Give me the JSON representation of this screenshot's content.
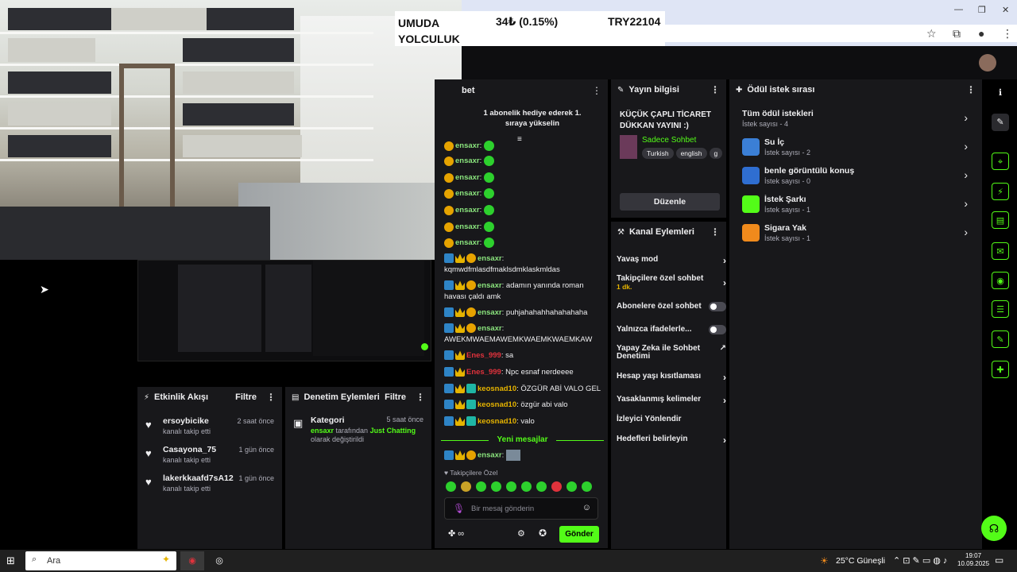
{
  "ticker": {
    "name_line1": "UMUDA",
    "name_line2": "YOLCULUK",
    "price": "34₺ (0.15%)",
    "goal": "TRY22104"
  },
  "activity": {
    "title": "Etkinlik Akışı",
    "filter": "Filtre",
    "items": [
      {
        "name": "ersoybicike",
        "sub": "kanalı takip etti",
        "time": "2 saat önce"
      },
      {
        "name": "Casayona_75",
        "sub": "kanalı takip etti",
        "time": "1 gün önce"
      },
      {
        "name": "lakerkkaafd7sA12",
        "sub": "kanalı takip etti",
        "time": "1 gün önce"
      }
    ]
  },
  "moderation": {
    "title": "Denetim Eylemleri",
    "filter": "Filtre",
    "item": {
      "title": "Kategori",
      "time": "5 saat önce",
      "user": "ensaxr",
      "mid": " tarafından ",
      "category": "Just Chatting",
      "end": "olarak değiştirildi"
    }
  },
  "chat": {
    "title_partial": "bet",
    "gift_banner": "1 abonelik hediye ederek 1. sıraya yükselin",
    "lines": [
      {
        "user": "ensaxr",
        "text": ""
      },
      {
        "user": "ensaxr",
        "text": ""
      },
      {
        "user": "ensaxr",
        "text": ""
      },
      {
        "user": "ensaxr",
        "text": ""
      },
      {
        "user": "ensaxr",
        "text": ""
      },
      {
        "user": "ensaxr",
        "text": ""
      },
      {
        "user": "ensaxr",
        "text": ""
      }
    ],
    "msg_kq": {
      "user": "ensaxr",
      "text": "kqmwdfmlasdfmaklsdmklaskmldas"
    },
    "msg_roman": {
      "user": "ensaxr",
      "text": ": adamın yanında roman havası çaldı amk"
    },
    "msg_puh": {
      "user": "ensaxr",
      "text": ": puhjahahahhahahahaha"
    },
    "msg_awek": {
      "user": "ensaxr",
      "text": "AWEKMWAEMAWEMKWAEMKWAEMKAW"
    },
    "msg_sa": {
      "user": "Enes_999",
      "text": ": sa"
    },
    "msg_npc": {
      "user": "Enes_999",
      "text": ": Npc esnaf nerdeeee"
    },
    "msg_ozgur1": {
      "user": "keosnad10",
      "text": ": ÖZGÜR ABİ VALO GEL"
    },
    "msg_ozgur2": {
      "user": "keosnad10",
      "text": ": özgür abi valo"
    },
    "msg_valo": {
      "user": "keosnad10",
      "text": ": valo"
    },
    "new_messages": "Yeni mesajlar",
    "msg_last": {
      "user": "ensaxr",
      "text": ":"
    },
    "followers_only": "Takipçilere Özel",
    "placeholder": "Bir mesaj gönderin",
    "send": "Gönder",
    "infinity": "∞"
  },
  "stream_info": {
    "title": "Yayın bilgisi",
    "stream_title": "KÜÇÜK ÇAPLI TİCARET DÜKKAN YAYINI :)",
    "category": "Sadece Sohbet",
    "tags": [
      "Turkish",
      "english",
      "g"
    ],
    "edit": "Düzenle"
  },
  "channel_actions": {
    "title": "Kanal Eylemleri",
    "slow": "Yavaş mod",
    "followers_chat": "Takipçilere özel sohbet",
    "followers_chat_sub": "1 dk.",
    "subs_chat": "Abonelere özel sohbet",
    "emotes": "Yalnızca ifadelerle...",
    "ai_mod_1": "Yapay Zeka ile Sohbet",
    "ai_mod_2": "Denetimi",
    "age": "Hesap yaşı kısıtlaması",
    "banned": "Yasaklanmış kelimeler",
    "redirect": "İzleyici Yönlendir",
    "goals": "Hedefleri belirleyin"
  },
  "rewards": {
    "title": "Ödül istek sırası",
    "items": [
      {
        "name": "Tüm ödül istekleri",
        "sub": "İstek sayısı - 4"
      },
      {
        "name": "Su İç",
        "sub": "İstek sayısı - 2",
        "color": "#3b7fd6"
      },
      {
        "name": "benle görüntülü konuş",
        "sub": "İstek sayısı - 0",
        "color": "#2f6ed1"
      },
      {
        "name": "İstek Şarkı",
        "sub": "İstek sayısı - 1",
        "color": "#53fc18"
      },
      {
        "name": "Sigara Yak",
        "sub": "İstek sayısı - 1",
        "color": "#f08a1c"
      }
    ]
  },
  "taskbar": {
    "search": "Ara",
    "weather": "25°C  Güneşli",
    "time": "19:07",
    "date": "10.09.2025"
  },
  "colors": {
    "accent": "#53fc18",
    "panel": "#18181b"
  }
}
